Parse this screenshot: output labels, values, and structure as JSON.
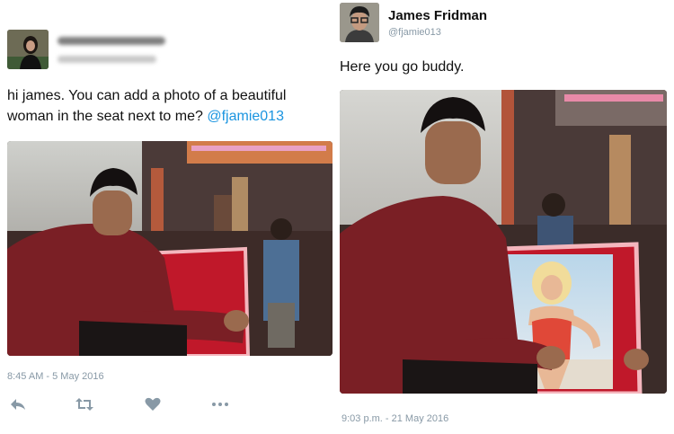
{
  "left_tweet": {
    "text": "hi james. You can add a photo of a beautiful woman in the seat next to me? ",
    "mention": "@fjamie013",
    "timestamp": "8:45 AM - 5 May 2016"
  },
  "right_tweet": {
    "name": "James Fridman",
    "handle": "@fjamie013",
    "text": "Here you go buddy.",
    "timestamp": "9:03 p.m. - 21 May 2016"
  },
  "actions": [
    {
      "icon": "reply-icon"
    },
    {
      "icon": "retweet-icon"
    },
    {
      "icon": "like-icon"
    },
    {
      "icon": "more-icon"
    }
  ],
  "colors": {
    "link": "#1b95e0",
    "meta": "#8899a6",
    "shirt": "#7a1f25",
    "cushion": "#c0182a"
  }
}
